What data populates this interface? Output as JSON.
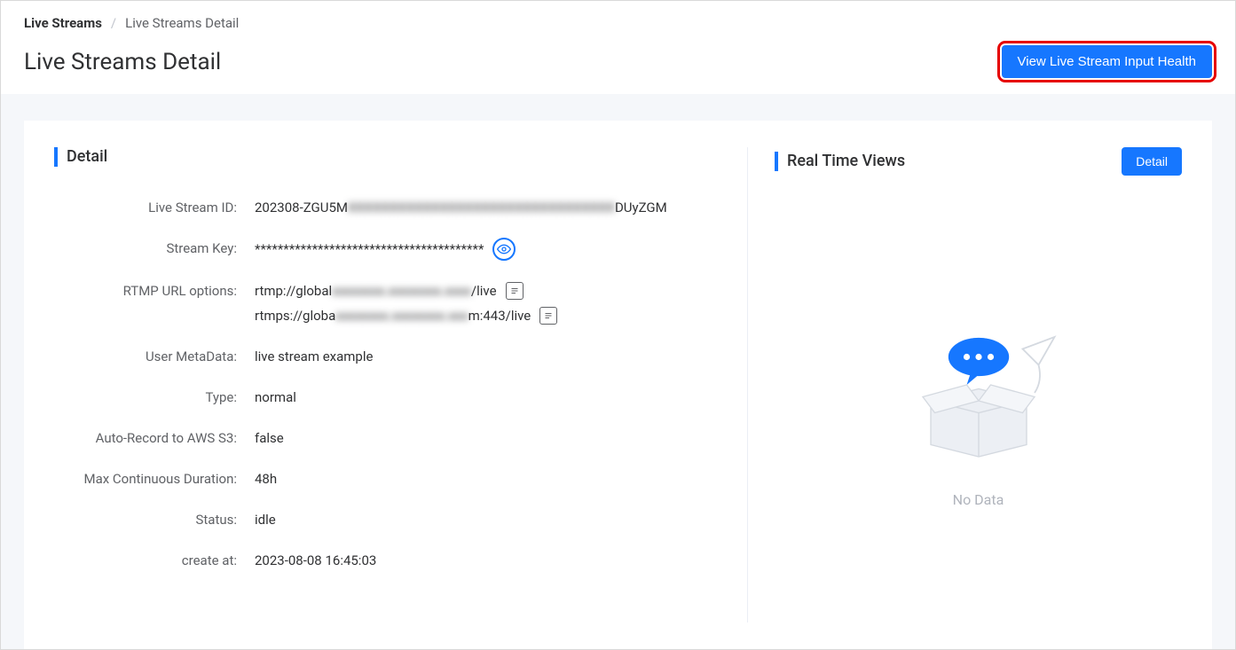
{
  "breadcrumb": {
    "root": "Live Streams",
    "separator": "/",
    "current": "Live Streams Detail"
  },
  "page_title": "Live Streams Detail",
  "header_button": "View Live Stream Input Health",
  "detail_section": {
    "title": "Detail",
    "fields": {
      "live_stream_id": {
        "label": "Live Stream ID:",
        "prefix": "202308-ZGU5M",
        "blurred": "XXXXXXXXXXXXXXXXXXXXXXXXXXXXXXXX",
        "suffix": "DUyZGM"
      },
      "stream_key": {
        "label": "Stream Key:",
        "value": "****************************************"
      },
      "rtmp_url": {
        "label": "RTMP URL options:",
        "line1_prefix": "rtmp://global",
        "line1_blurred": "xxxxxxxx.xxxxxxxx.xxxx",
        "line1_suffix": "/live",
        "line2_prefix": "rtmps://globa",
        "line2_blurred": "xxxxxxxx.xxxxxxxx.xxx",
        "line2_suffix": "m:443/live"
      },
      "user_metadata": {
        "label": "User MetaData:",
        "value": "live stream example"
      },
      "type": {
        "label": "Type:",
        "value": "normal"
      },
      "auto_record": {
        "label": "Auto-Record to AWS S3:",
        "value": "false"
      },
      "max_duration": {
        "label": "Max Continuous Duration:",
        "value": "48h"
      },
      "status": {
        "label": "Status:",
        "value": "idle"
      },
      "created_at": {
        "label": "create at:",
        "value": "2023-08-08 16:45:03"
      }
    }
  },
  "realtime_section": {
    "title": "Real Time Views",
    "button": "Detail",
    "empty_text": "No Data"
  }
}
